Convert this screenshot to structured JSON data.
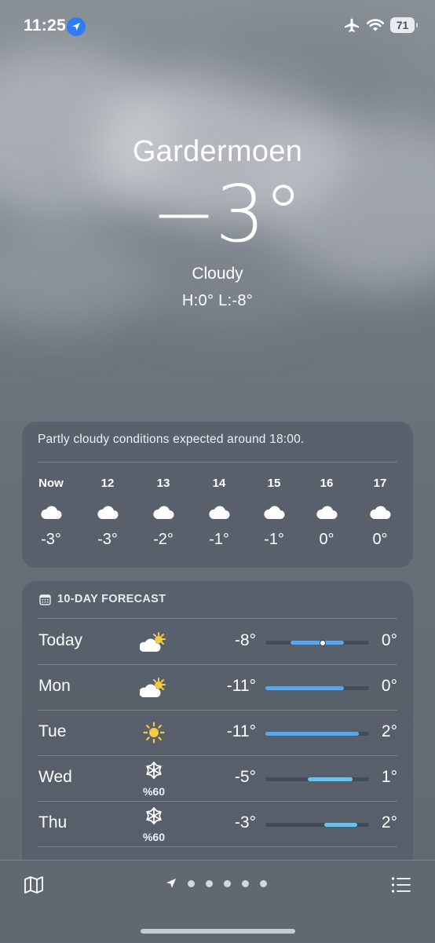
{
  "status": {
    "time": "11:25",
    "battery": "71",
    "icons": [
      "location-icon",
      "airplane-icon",
      "wifi-icon",
      "battery-icon"
    ]
  },
  "current": {
    "city": "Gardermoen",
    "temp": "−3°",
    "condition": "Cloudy",
    "high_low": "H:0°  L:-8°"
  },
  "hourly": {
    "note": "Partly cloudy conditions expected around 18:00.",
    "hours": [
      {
        "label": "Now",
        "temp": "-3°",
        "icon": "cloud-icon"
      },
      {
        "label": "12",
        "temp": "-3°",
        "icon": "cloud-icon"
      },
      {
        "label": "13",
        "temp": "-2°",
        "icon": "cloud-icon"
      },
      {
        "label": "14",
        "temp": "-1°",
        "icon": "cloud-icon"
      },
      {
        "label": "15",
        "temp": "-1°",
        "icon": "cloud-icon"
      },
      {
        "label": "16",
        "temp": "0°",
        "icon": "cloud-icon"
      },
      {
        "label": "17",
        "temp": "0°",
        "icon": "cloud-icon"
      }
    ]
  },
  "forecast": {
    "title": "10-DAY FORECAST",
    "days": [
      {
        "day": "Today",
        "icon": "partly-sunny-icon",
        "low": "-8°",
        "high": "0°",
        "bar_start": 0.24,
        "bar_end": 0.76,
        "current_marker": 0.55
      },
      {
        "day": "Mon",
        "icon": "partly-sunny-icon",
        "low": "-11°",
        "high": "0°",
        "bar_start": 0.0,
        "bar_end": 0.76
      },
      {
        "day": "Tue",
        "icon": "sun-icon",
        "low": "-11°",
        "high": "2°",
        "bar_start": 0.0,
        "bar_end": 0.9
      },
      {
        "day": "Wed",
        "icon": "snowflake-icon",
        "precip": "%60",
        "low": "-5°",
        "high": "1°",
        "bar_start": 0.41,
        "bar_end": 0.84
      },
      {
        "day": "Thu",
        "icon": "snowflake-icon",
        "precip": "%60",
        "low": "-3°",
        "high": "2°",
        "bar_start": 0.57,
        "bar_end": 0.89
      }
    ]
  },
  "colors": {
    "bar_cool": "#5aa6e8",
    "bar_mild": "#6cc0ee",
    "sun": "#f7c943"
  },
  "tabbar": {
    "page_count": 5,
    "icons": [
      "map-icon",
      "location-arrow-icon",
      "list-icon"
    ]
  }
}
